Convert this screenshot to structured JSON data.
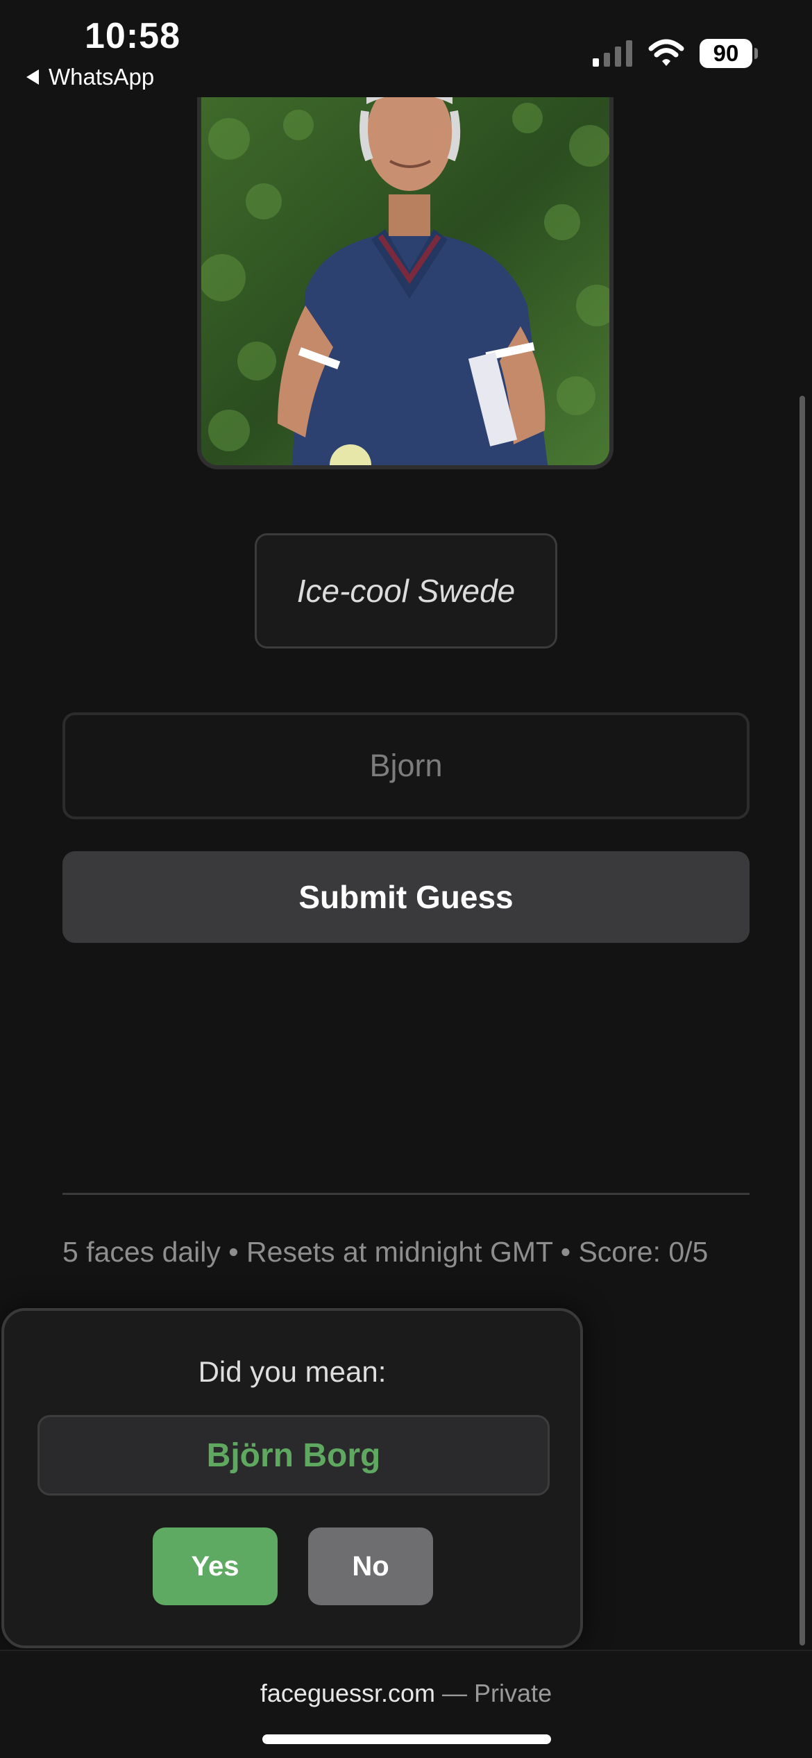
{
  "status_bar": {
    "time": "10:58",
    "back_app": "WhatsApp",
    "battery": "90",
    "icons": [
      "signal-icon",
      "wifi-icon",
      "battery-icon"
    ]
  },
  "game": {
    "photo_alt": "face-photo",
    "hint": "Ice-cool Swede",
    "input": {
      "value": "",
      "placeholder": "Bjorn"
    },
    "submit_label": "Submit Guess",
    "footer_info": "5 faces daily • Resets at midnight GMT • Score: 0/5"
  },
  "popup": {
    "title": "Did you mean:",
    "suggestion": "Björn Borg",
    "yes_label": "Yes",
    "no_label": "No"
  },
  "browser": {
    "domain": "faceguessr.com",
    "separator": " — ",
    "mode": "Private"
  },
  "colors": {
    "background": "#131313",
    "accent_green": "#5faa62",
    "suggestion_green": "#5fa85f",
    "button_gray": "#3a3a3c"
  }
}
